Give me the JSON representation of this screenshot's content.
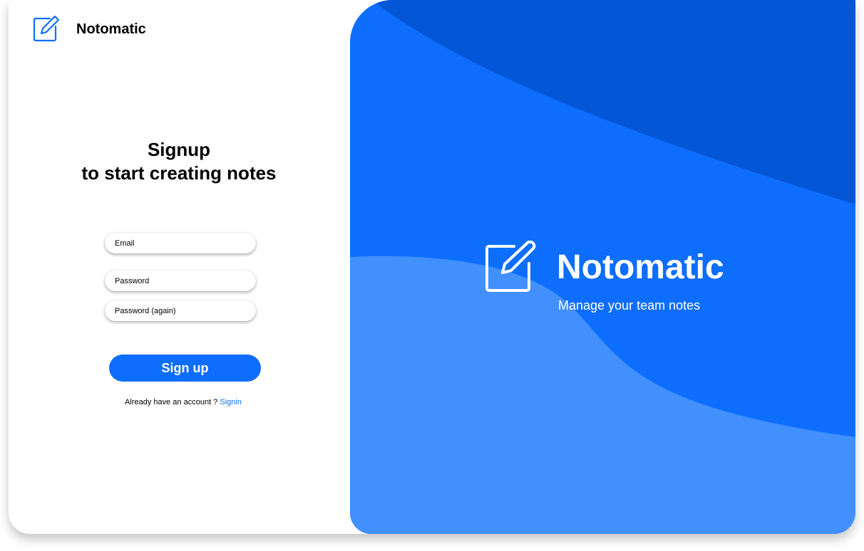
{
  "brand": {
    "name": "Notomatic",
    "icon": "edit-note-icon",
    "accent_color": "#0d6efd"
  },
  "form": {
    "heading_line1": "Signup",
    "heading_line2": "to start creating notes",
    "email_placeholder": "Email",
    "password_placeholder": "Password",
    "password_again_placeholder": "Password (again)",
    "submit_label": "Sign up",
    "signin_prompt": "Already have an account ?",
    "signin_link": "Signin"
  },
  "hero": {
    "title": "Notomatic",
    "subtitle": "Manage your team notes",
    "icon": "edit-note-icon",
    "colors": {
      "base": "#0d6efd",
      "dark_wave": "#0356d6",
      "light_wave": "#428ffe"
    }
  }
}
